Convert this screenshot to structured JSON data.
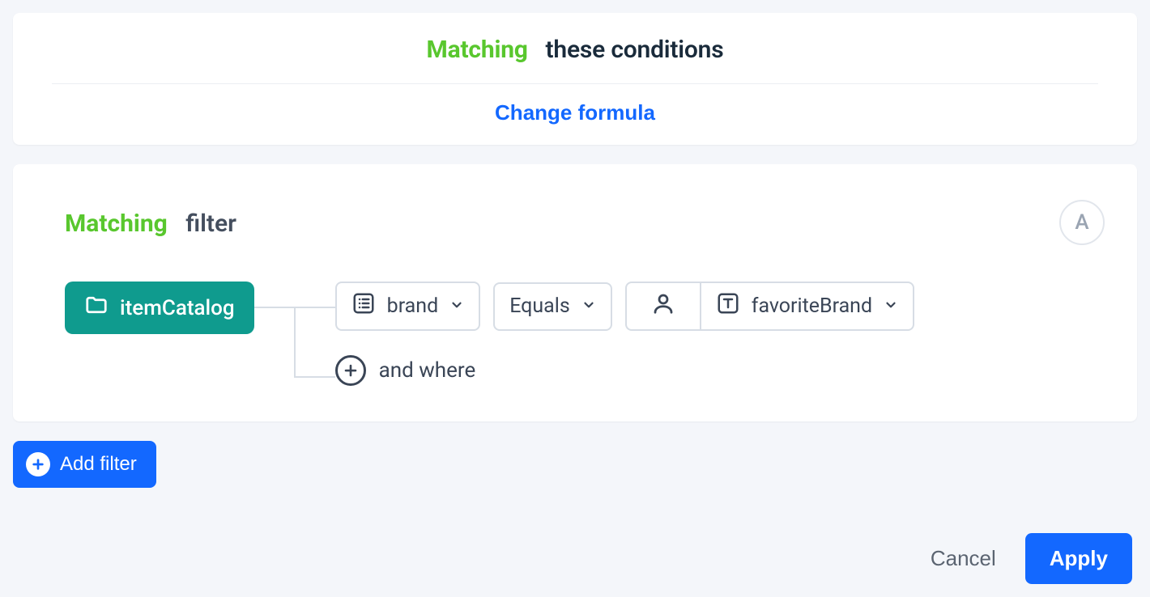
{
  "header": {
    "matching": "Matching",
    "conditions_text": "these conditions",
    "change_formula": "Change formula"
  },
  "filter": {
    "matching": "Matching",
    "filter_text": "filter",
    "badge": "A",
    "catalog_label": "itemCatalog",
    "condition": {
      "field": "brand",
      "operator": "Equals",
      "value_field": "favoriteBrand"
    },
    "and_where_label": "and where"
  },
  "buttons": {
    "add_filter": "Add filter",
    "cancel": "Cancel",
    "apply": "Apply"
  }
}
